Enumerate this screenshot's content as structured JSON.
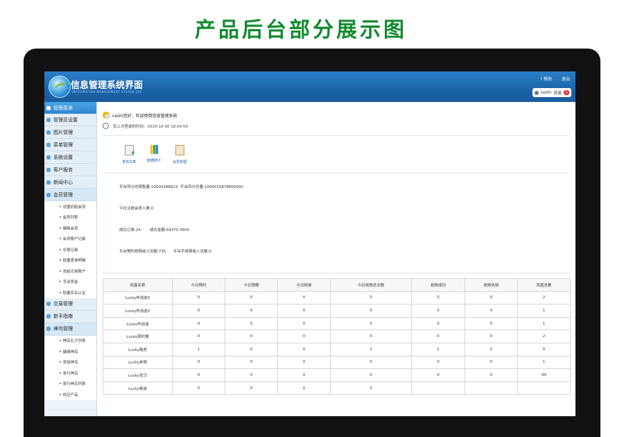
{
  "banner_title": "产品后台部分展示图",
  "header": {
    "title": "信息管理系统界面",
    "subtitle": "INFORMATION MANAGEMENT SYSTEM 365",
    "help_label": "帮助",
    "logout_label": "退出",
    "username": "ceshi",
    "messages_label": "消息",
    "message_count": "5"
  },
  "sidebar": {
    "head": "管理菜单",
    "groups_top": [
      "管理员设置",
      "图片管理",
      "菜单管理",
      "系统设置",
      "客户服务",
      "新闻中心"
    ],
    "group_member": "会员管理",
    "member_items": [
      "设置初始会员",
      "会员列表",
      "编辑会员",
      "会员账户记录",
      "交易记录",
      "批量查询明细",
      "冻结无用账户",
      "手动奖金",
      "批量实名认证"
    ],
    "groups_mid": [
      "交易管理",
      "新手指南"
    ],
    "group_bird": "神鸟管理",
    "bird_items": [
      "神鸟孔子列表",
      "编辑神鸟",
      "添加神鸟",
      "发行神鸟",
      "发行神鸟列表",
      "供应产品"
    ]
  },
  "main": {
    "welcome": "ceshi您好，欢迎使用信息管理系统",
    "last_login": "您上次登录的时间：2019-10-30 18:04:59",
    "quick_links": [
      "发布文章",
      "数据统计",
      "会员管理"
    ],
    "stats": {
      "bird_total": "平台凤分总销售量:10000188923",
      "bird_total_value": "平台凤分总量:1000015878800000",
      "today_members": "今日注册会员人数:0",
      "orders": "成交订单:24",
      "amount": "成交金额:64370.3600",
      "platform_income": "平台预约抢购收入总额:735",
      "fee_income": "平台手续费收入总额:0"
    },
    "table": {
      "headers": [
        "凤凰名称",
        "今日预约",
        "今日预期",
        "今日抢单",
        "今日抢购总次数",
        "抢购成功",
        "抢购失败",
        "凤凰总数"
      ],
      "rows": [
        [
          "Lucky布加迪3",
          "0",
          "0",
          "0",
          "0",
          "0",
          "0",
          "2"
        ],
        [
          "Lucky布加迪2",
          "0",
          "0",
          "0",
          "0",
          "0",
          "0",
          "1"
        ],
        [
          "Lucky布加迪",
          "0",
          "0",
          "0",
          "0",
          "0",
          "0",
          "1"
        ],
        [
          "Lucky保时捷",
          "0",
          "0",
          "0",
          "0",
          "0",
          "0",
          "2"
        ],
        [
          "Lucky路虎",
          "1",
          "0",
          "0",
          "1",
          "1",
          "0",
          "0"
        ],
        [
          "Lucky奔驰",
          "0",
          "0",
          "0",
          "0",
          "0",
          "0",
          "1"
        ],
        [
          "Lucky宝马",
          "0",
          "0",
          "0",
          "0",
          "0",
          "0",
          "99"
        ],
        [
          "Lucky奥迪",
          "0",
          "0",
          "0",
          "0",
          "",
          "",
          ""
        ]
      ]
    }
  }
}
